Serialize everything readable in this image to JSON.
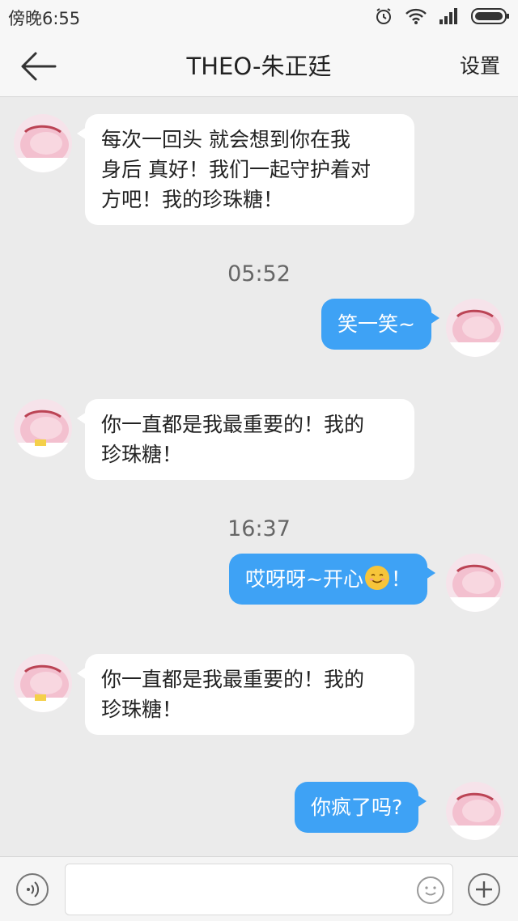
{
  "status_bar": {
    "time": "傍晚6:55",
    "icons": [
      "alarm-icon",
      "wifi-icon",
      "signal-icon",
      "battery-icon"
    ]
  },
  "nav": {
    "title": "THEO-朱正廷",
    "settings_label": "设置",
    "back_icon": "arrow-left-icon"
  },
  "messages": [
    {
      "type": "in",
      "text": "每次一回头 就会想到你在我\n身后 真好！我们一起守护着对\n方吧！我的珍珠糖！"
    },
    {
      "type": "time",
      "text": "05:52"
    },
    {
      "type": "out",
      "text": "笑一笑~"
    },
    {
      "type": "in",
      "text": "你一直都是我最重要的！我的\n珍珠糖！"
    },
    {
      "type": "time",
      "text": "16:37"
    },
    {
      "type": "out",
      "text_before": "哎呀呀~开心",
      "emoji": "smiling-face-emoji",
      "text_after": "！"
    },
    {
      "type": "in",
      "text": "你一直都是我最重要的！我的\n珍珠糖！"
    },
    {
      "type": "out",
      "text": "你疯了吗?"
    }
  ],
  "input_bar": {
    "placeholder": "",
    "voice_icon": "voice-icon",
    "emoji_icon": "smiley-icon",
    "plus_icon": "plus-icon"
  },
  "colors": {
    "outgoing_bubble": "#3ea2f5",
    "incoming_bubble": "#ffffff",
    "background": "#ebebeb"
  }
}
